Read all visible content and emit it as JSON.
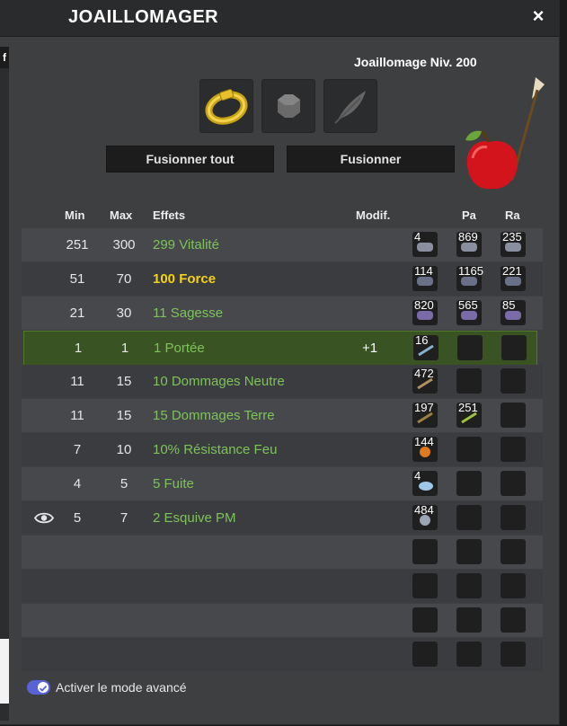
{
  "window": {
    "title": "JOAILLOMAGER",
    "close_glyph": "×"
  },
  "left_tab_label": "f",
  "job": {
    "level_label": "Joaillomage Niv. 200"
  },
  "slots": [
    {
      "icon": "gold-ring-icon",
      "label": ""
    },
    {
      "icon": "rune-slot-icon",
      "label": ""
    },
    {
      "icon": "feather-icon",
      "label": ""
    }
  ],
  "buttons": {
    "merge_all": "Fusionner tout",
    "merge": "Fusionner"
  },
  "columns": {
    "min": "Min",
    "max": "Max",
    "effects": "Effets",
    "modif": "Modif.",
    "pa": "Pa",
    "ra": "Ra"
  },
  "rows": [
    {
      "min": "251",
      "max": "300",
      "effect": "299 Vitalité",
      "modif": "",
      "ba": "4",
      "pa": "869",
      "ra": "235",
      "style": "green"
    },
    {
      "min": "51",
      "max": "70",
      "effect": "100 Force",
      "modif": "",
      "ba": "114",
      "pa": "1165",
      "ra": "221",
      "style": "yellow"
    },
    {
      "min": "21",
      "max": "30",
      "effect": "11 Sagesse",
      "modif": "",
      "ba": "820",
      "pa": "565",
      "ra": "85",
      "style": "green"
    },
    {
      "min": "1",
      "max": "1",
      "effect": "1 Portée",
      "modif": "+1",
      "ba": "16",
      "pa": "",
      "ra": "",
      "style": "green"
    },
    {
      "min": "11",
      "max": "15",
      "effect": "10 Dommages Neutre",
      "modif": "",
      "ba": "472",
      "pa": "",
      "ra": "",
      "style": "green"
    },
    {
      "min": "11",
      "max": "15",
      "effect": "15 Dommages Terre",
      "modif": "",
      "ba": "197",
      "pa": "251",
      "ra": "",
      "style": "green"
    },
    {
      "min": "7",
      "max": "10",
      "effect": "10% Résistance Feu",
      "modif": "",
      "ba": "144",
      "pa": "",
      "ra": "",
      "style": "green"
    },
    {
      "min": "4",
      "max": "5",
      "effect": "5 Fuite",
      "modif": "",
      "ba": "4",
      "pa": "",
      "ra": "",
      "style": "green"
    },
    {
      "min": "5",
      "max": "7",
      "effect": "2 Esquive PM",
      "modif": "",
      "ba": "484",
      "pa": "",
      "ra": "",
      "style": "green"
    }
  ],
  "advanced_mode": {
    "label": "Activer le mode avancé",
    "enabled": true
  },
  "colors": {
    "accent": "#5a63d6",
    "effect_green": "#7dc35a",
    "effect_yellow": "#f3d21a",
    "highlight": "#3a5323"
  }
}
